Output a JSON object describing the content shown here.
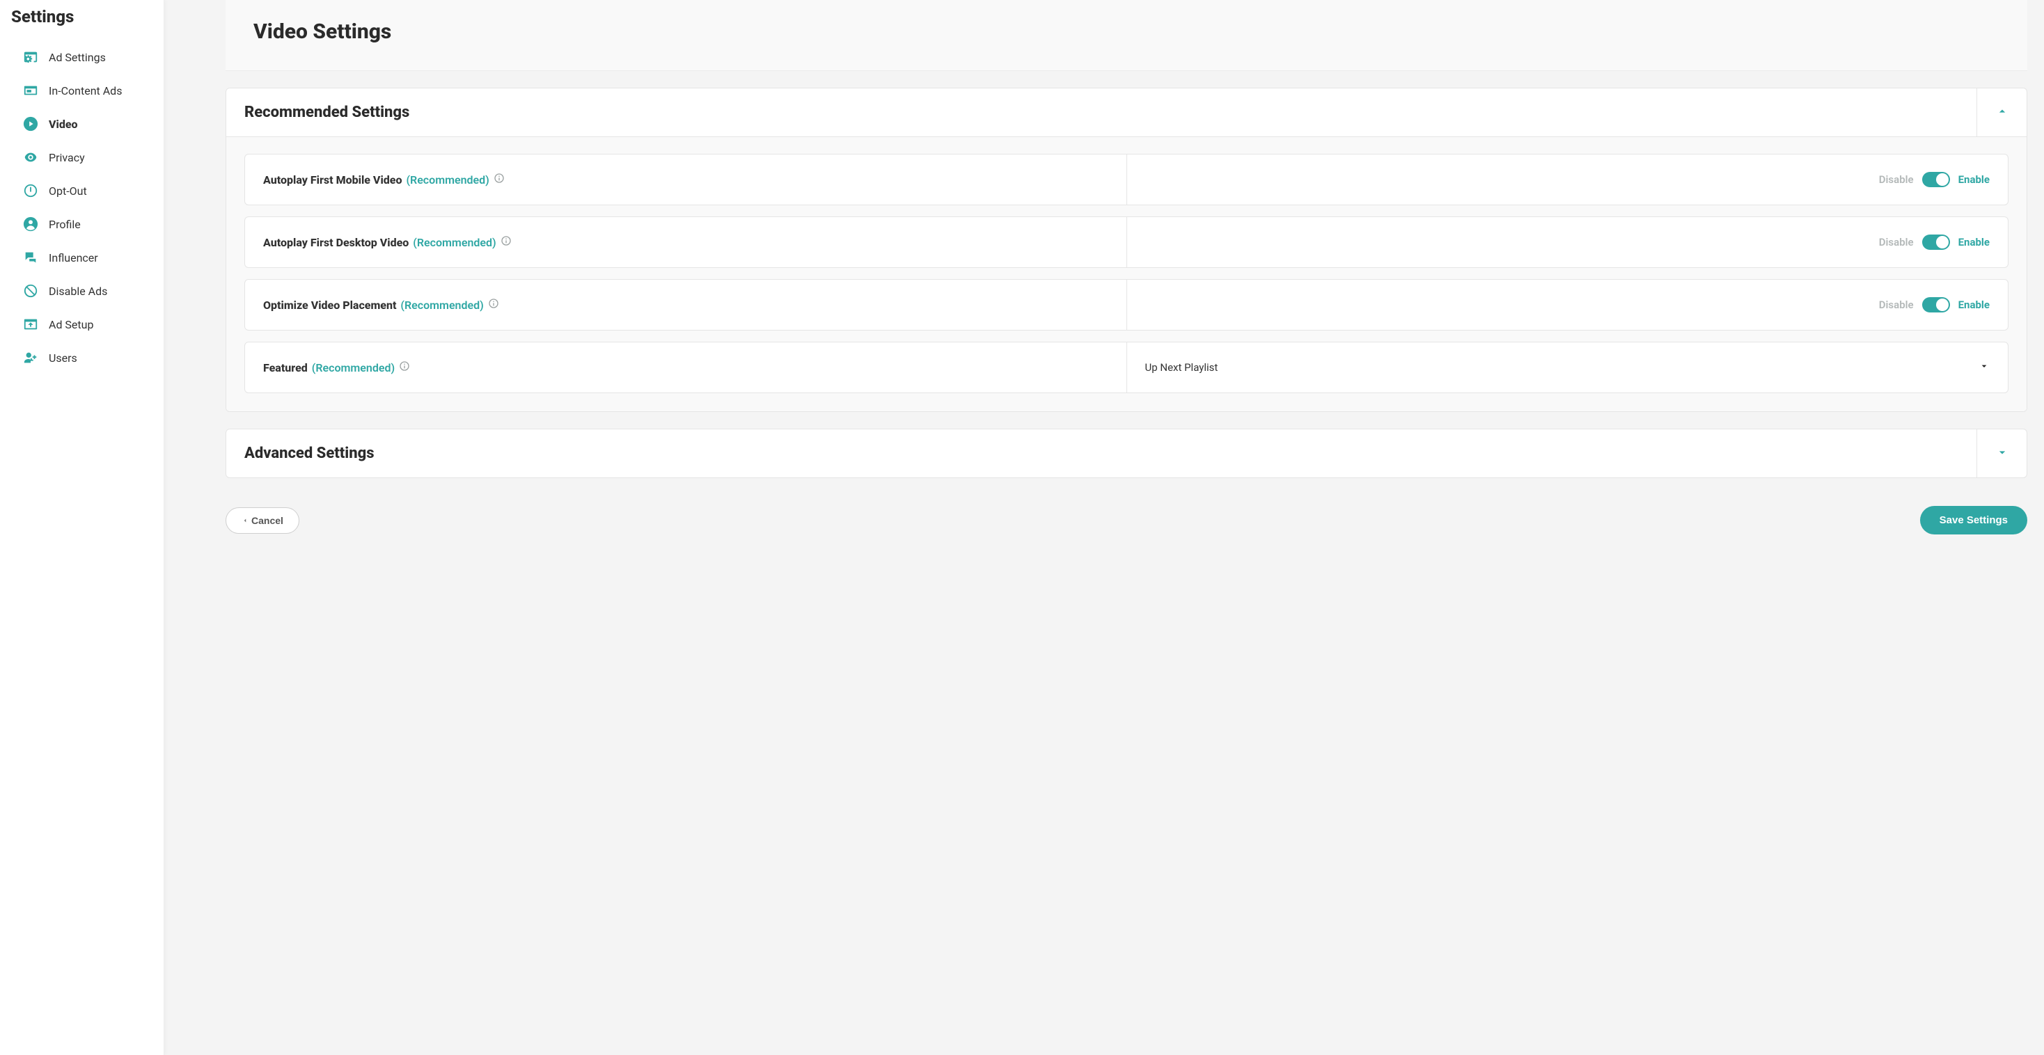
{
  "sidebar": {
    "title": "Settings",
    "items": [
      {
        "label": "Ad Settings",
        "icon": "ad-settings-icon",
        "active": false
      },
      {
        "label": "In-Content Ads",
        "icon": "in-content-ads-icon",
        "active": false
      },
      {
        "label": "Video",
        "icon": "video-icon",
        "active": true
      },
      {
        "label": "Privacy",
        "icon": "privacy-icon",
        "active": false
      },
      {
        "label": "Opt-Out",
        "icon": "opt-out-icon",
        "active": false
      },
      {
        "label": "Profile",
        "icon": "profile-icon",
        "active": false
      },
      {
        "label": "Influencer",
        "icon": "influencer-icon",
        "active": false
      },
      {
        "label": "Disable Ads",
        "icon": "disable-ads-icon",
        "active": false
      },
      {
        "label": "Ad Setup",
        "icon": "ad-setup-icon",
        "active": false
      },
      {
        "label": "Users",
        "icon": "users-icon",
        "active": false
      }
    ]
  },
  "page_title": "Video Settings",
  "panels": {
    "recommended": {
      "title": "Recommended Settings",
      "expanded": true,
      "labels": {
        "disable": "Disable",
        "enable": "Enable",
        "recommended": "(Recommended)"
      },
      "rows": [
        {
          "title": "Autoplay First Mobile Video",
          "recommended": true,
          "enabled": true
        },
        {
          "title": "Autoplay First Desktop Video",
          "recommended": true,
          "enabled": true
        },
        {
          "title": "Optimize Video Placement",
          "recommended": true,
          "enabled": true
        }
      ],
      "featured": {
        "title": "Featured",
        "recommended": true,
        "selected": "Up Next Playlist"
      }
    },
    "advanced": {
      "title": "Advanced Settings",
      "expanded": false
    }
  },
  "actions": {
    "cancel": "Cancel",
    "save": "Save Settings"
  },
  "colors": {
    "accent": "#2fa7a4"
  }
}
